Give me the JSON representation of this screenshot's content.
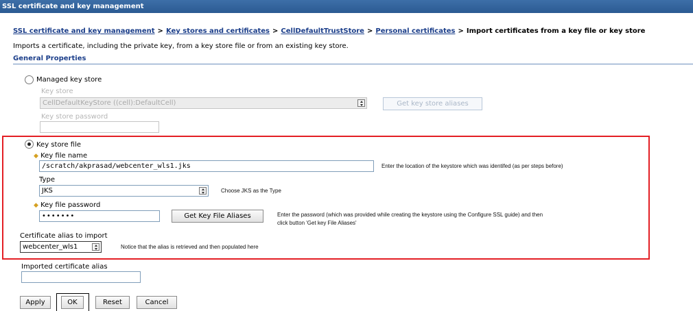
{
  "title_bar": "SSL certificate and key management",
  "breadcrumb": {
    "items": [
      "SSL certificate and key management",
      "Key stores and certificates",
      "CellDefaultTrustStore",
      "Personal certificates"
    ],
    "separator": ">",
    "current": "Import certificates from a key file or key store"
  },
  "description": "Imports a certificate, including the private key, from a key store file or from an existing key store.",
  "section_title": "General Properties",
  "managed": {
    "radio_label": "Managed key store",
    "selected": false,
    "keystore_label": "Key store",
    "keystore_value": "CellDefaultKeyStore ((cell):DefaultCell)",
    "aliases_button": "Get key store aliases",
    "password_label": "Key store password"
  },
  "keyfile": {
    "radio_label": "Key store file",
    "selected": true,
    "name_label": "Key file name",
    "name_value": "/scratch/akprasad/webcenter_wls1.jks",
    "name_note": "Enter the location of the keystore which was identifed (as per steps before)",
    "type_label": "Type",
    "type_value": "JKS",
    "type_note": "Choose JKS as the Type",
    "password_label": "Key file password",
    "password_value": "•••••••",
    "aliases_button": "Get Key File Aliases",
    "password_note_1": "Enter the password (which was provided while creating the keystore using the Configure SSL guide) and then",
    "password_note_2": "click button 'Get key File Aliases'"
  },
  "alias": {
    "label": "Certificate alias to import",
    "value": "webcenter_wls1",
    "note": "Notice that the alias is retrieved and then populated here"
  },
  "imported_alias": {
    "label": "Imported certificate alias",
    "value": ""
  },
  "buttons": {
    "apply": "Apply",
    "ok": "OK",
    "reset": "Reset",
    "cancel": "Cancel"
  },
  "colors": {
    "title_bar": "#2b5a92",
    "link": "#1b3e8a",
    "highlight_box": "#e31e24",
    "required_star": "#d5a021"
  }
}
